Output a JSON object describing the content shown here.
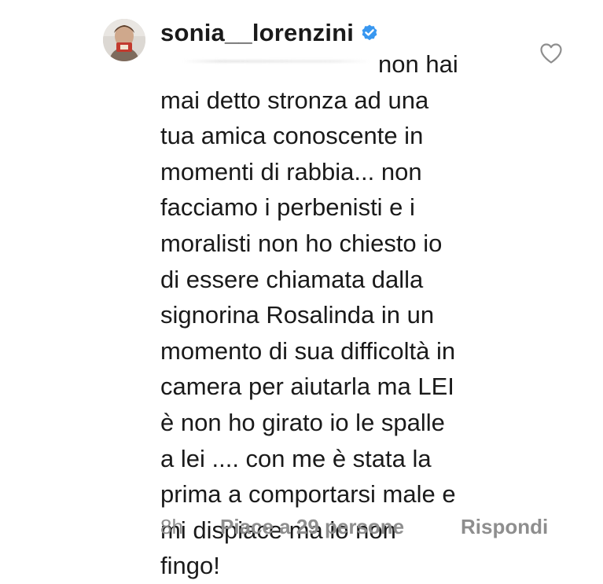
{
  "comment": {
    "username": "sonia__lorenzini",
    "verified": true,
    "text_first_line": "non hai",
    "text_lines": [
      "mai detto stronza ad una",
      "tua amica conoscente in",
      "momenti di rabbia... non",
      "facciamo i perbenisti e i",
      "moralisti non ho chiesto io",
      "di essere chiamata dalla",
      "signorina Rosalinda in un",
      "momento di sua difficoltà in",
      "camera per aiutarla ma LEI",
      "è non ho girato io le spalle",
      "a lei .... con me è stata la",
      "prima a comportarsi male e",
      "mi dispiace ma io non",
      "fingo!"
    ],
    "time": "8h",
    "likes_label": "Piace a 29 persone",
    "reply_label": "Rispondi"
  },
  "colors": {
    "text": "#1a1a1a",
    "meta": "#8e8e8e",
    "verified_badge": "#3897f0",
    "background": "#ffffff"
  },
  "icons": {
    "like": "heart-outline-icon",
    "verified": "verified-badge-icon"
  }
}
